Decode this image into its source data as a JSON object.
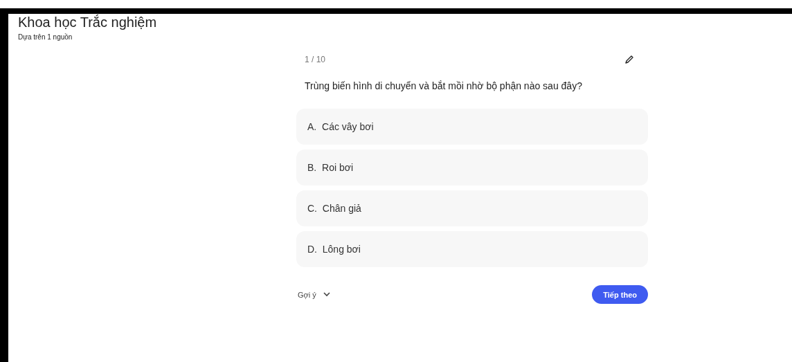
{
  "header": {
    "title": "Khoa học Trắc nghiệm",
    "subtitle": "Dựa trên 1 nguồn"
  },
  "quiz": {
    "progress": "1 / 10",
    "question": "Trùng biến hình di chuyển và bắt mồi nhờ bộ phận nào sau đây?",
    "options": [
      {
        "letter": "A.",
        "text": "Các vây bơi"
      },
      {
        "letter": "B.",
        "text": "Roi bơi"
      },
      {
        "letter": "C.",
        "text": "Chân giả"
      },
      {
        "letter": "D.",
        "text": "Lông bơi"
      }
    ],
    "hint": "Gợi ý",
    "next_button": "Tiếp theo"
  }
}
